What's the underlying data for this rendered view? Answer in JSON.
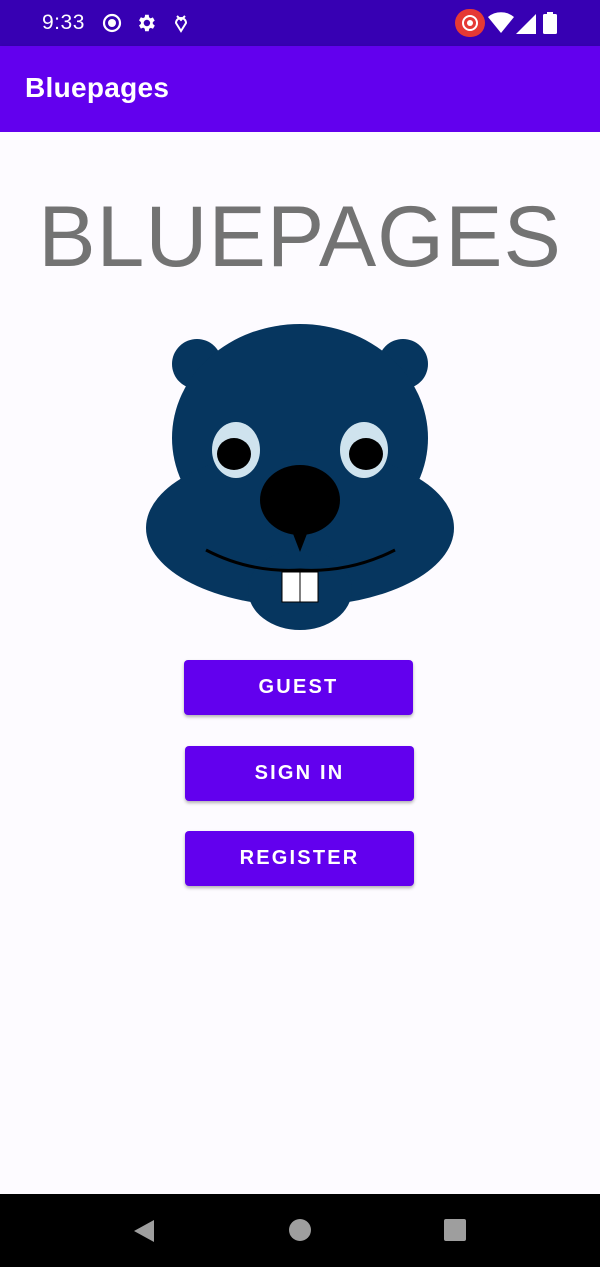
{
  "status_bar": {
    "time": "9:33",
    "icons": [
      "record-icon",
      "settings-gear-icon",
      "download-shield-icon",
      "screen-record-icon",
      "wifi-icon",
      "cell-signal-icon",
      "battery-icon"
    ]
  },
  "app_bar": {
    "title": "Bluepages"
  },
  "main": {
    "heading": "BLUEPAGES",
    "mascot": "beaver-mascot-image",
    "buttons": {
      "guest": "GUEST",
      "sign_in": "SIGN IN",
      "register": "REGISTER"
    }
  },
  "nav_bar": {
    "icons": [
      "back-icon",
      "home-icon",
      "recents-icon"
    ]
  },
  "colors": {
    "status_bar": "#3700b3",
    "app_bar": "#6200ee",
    "button": "#6200ee",
    "heading_text": "#737373",
    "mascot_fur": "#06365f"
  }
}
